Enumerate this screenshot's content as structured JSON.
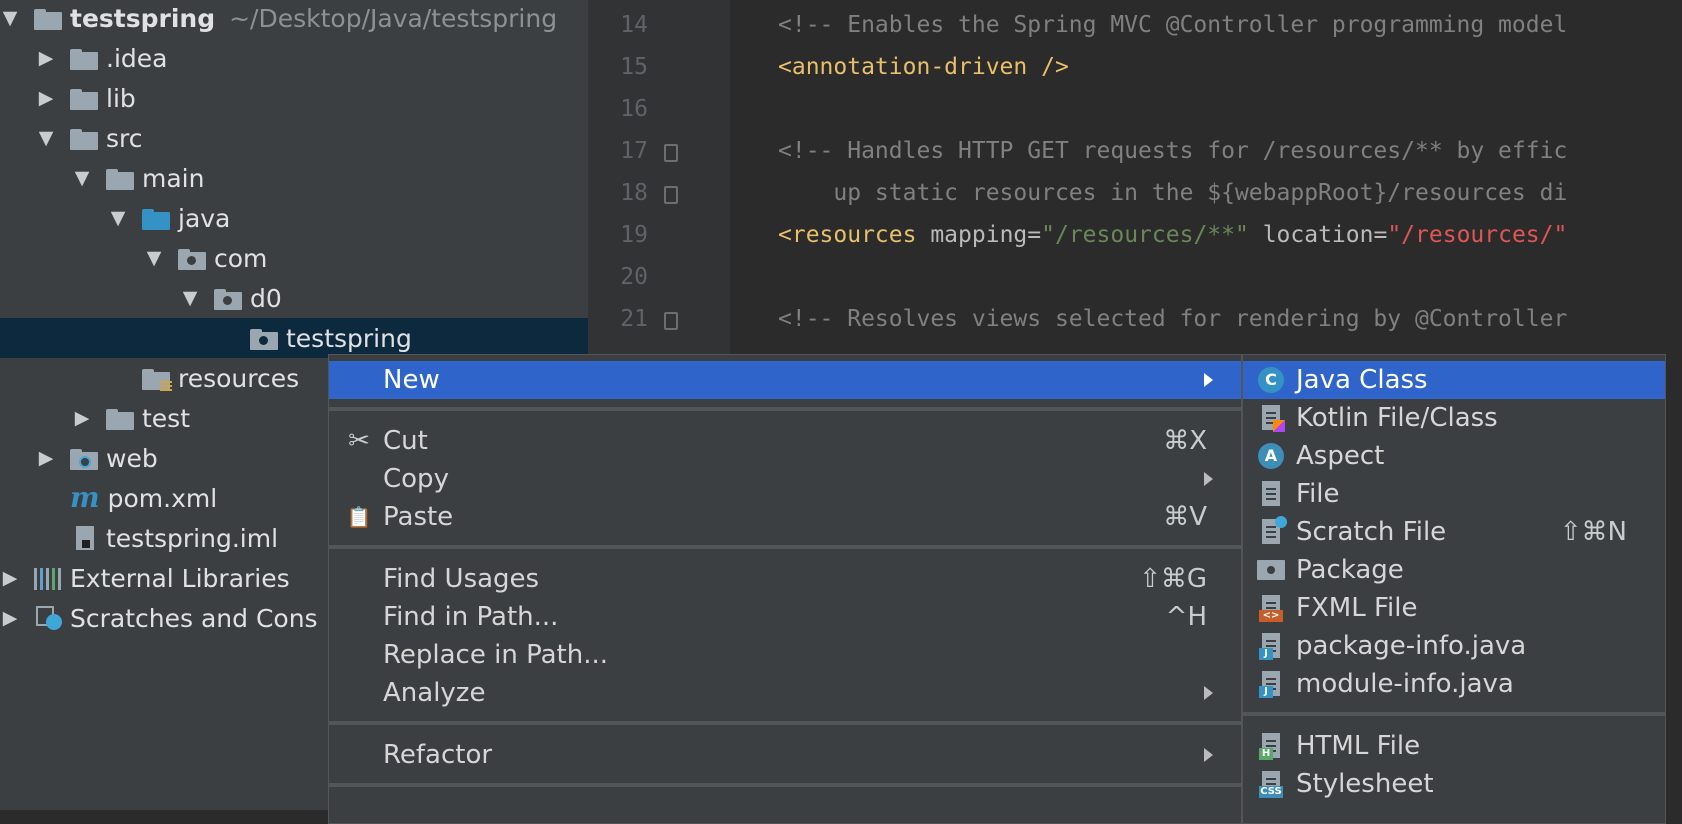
{
  "tree": {
    "project_name": "testspring",
    "project_path": "~/Desktop/Java/testspring",
    "items": [
      {
        "label": "testspring"
      },
      {
        "label": ".idea"
      },
      {
        "label": "lib"
      },
      {
        "label": "src"
      },
      {
        "label": "main"
      },
      {
        "label": "java"
      },
      {
        "label": "com"
      },
      {
        "label": "d0"
      },
      {
        "label": "testspring"
      },
      {
        "label": "resources"
      },
      {
        "label": "test"
      },
      {
        "label": "web"
      },
      {
        "label": "pom.xml"
      },
      {
        "label": "testspring.iml"
      },
      {
        "label": "External Libraries"
      },
      {
        "label": "Scratches and Cons"
      }
    ]
  },
  "editor": {
    "line_numbers": [
      "14",
      "15",
      "16",
      "17",
      "18",
      "19",
      "20",
      "21"
    ],
    "lines": [
      {
        "comment": "<!-- Enables the Spring MVC @Controller programming model"
      },
      {
        "tag": "<annotation-driven />"
      },
      {},
      {
        "comment": "<!-- Handles HTTP GET requests for /resources/** by effic"
      },
      {
        "comment": "    up static resources in the ${webappRoot}/resources di"
      },
      {
        "tag_open": "<resources",
        "attr1": " mapping",
        "eq1": "=",
        "val1": "\"/resources/**\"",
        "attr2": " location",
        "eq2": "=",
        "val2": "\"/resources/\""
      },
      {},
      {
        "comment": "<!-- Resolves views selected for rendering by @Controller"
      }
    ]
  },
  "context_menu": {
    "items": [
      {
        "label": "New",
        "shortcut": "",
        "submenu": true
      },
      {
        "label": "Cut",
        "shortcut": "⌘X",
        "icon": "scissors-icon"
      },
      {
        "label": "Copy",
        "shortcut": "",
        "submenu": true
      },
      {
        "label": "Paste",
        "shortcut": "⌘V",
        "icon": "clipboard-icon"
      },
      {
        "label": "Find Usages",
        "shortcut": "⇧⌘G"
      },
      {
        "label": "Find in Path...",
        "shortcut": "^H"
      },
      {
        "label": "Replace in Path...",
        "shortcut": ""
      },
      {
        "label": "Analyze",
        "shortcut": "",
        "submenu": true
      },
      {
        "label": "Refactor",
        "shortcut": "",
        "submenu": true
      }
    ],
    "icons": {
      "cut": "✂",
      "paste": "📋"
    }
  },
  "new_submenu": {
    "items": [
      {
        "label": "Java Class",
        "icon": "java-class-icon",
        "badge": "C"
      },
      {
        "label": "Kotlin File/Class",
        "icon": "kotlin-file-icon"
      },
      {
        "label": "Aspect",
        "icon": "aspect-icon",
        "badge": "A"
      },
      {
        "label": "File",
        "icon": "file-icon"
      },
      {
        "label": "Scratch File",
        "icon": "scratch-file-icon",
        "shortcut": "⇧⌘N"
      },
      {
        "label": "Package",
        "icon": "package-icon"
      },
      {
        "label": "FXML File",
        "icon": "fxml-file-icon",
        "badge": "<>"
      },
      {
        "label": "package-info.java",
        "icon": "java-file-icon",
        "badge": "J"
      },
      {
        "label": "module-info.java",
        "icon": "java-file-icon",
        "badge": "J"
      },
      {
        "label": "HTML File",
        "icon": "html-file-icon",
        "badge": "H"
      },
      {
        "label": "Stylesheet",
        "icon": "css-file-icon",
        "badge": "CSS"
      }
    ]
  },
  "colors": {
    "highlight": "#2f65ca",
    "tree_selection": "#0d293e",
    "java_blue": "#3592c4",
    "aspect_blue": "#3d8fba",
    "fxml_orange": "#c75e2a",
    "html_green": "#59a869",
    "css_blue": "#3d8fba"
  }
}
